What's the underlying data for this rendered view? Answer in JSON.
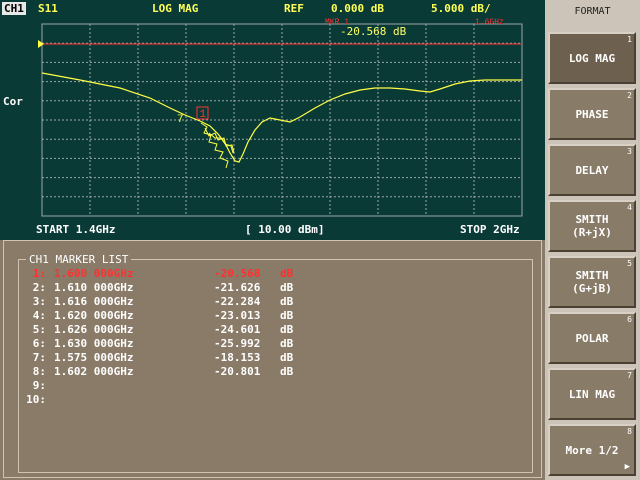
{
  "header": {
    "channel": "CH1",
    "parameter": "S11",
    "format": "LOG MAG",
    "ref_label": "REF",
    "ref_value": "0.000 dB",
    "scale": "5.000 dB/"
  },
  "graph": {
    "left_label": "Cor",
    "marker_readout": "-20.568 dB",
    "start": "START 1.4GHz",
    "power": "[ 10.00 dBm]",
    "stop": "STOP 2GHz",
    "trace_color": "#ffff44",
    "grid_color": "#9aa6a4",
    "ref_line_color": "#ff3333"
  },
  "marker_list": {
    "title": "CH1 MARKER LIST",
    "rows": [
      {
        "idx": "1:",
        "freq": "1.600 000GHz",
        "value": "-20.568",
        "unit": "dB",
        "active": true
      },
      {
        "idx": "2:",
        "freq": "1.610 000GHz",
        "value": "-21.626",
        "unit": "dB",
        "active": false
      },
      {
        "idx": "3:",
        "freq": "1.616 000GHz",
        "value": "-22.284",
        "unit": "dB",
        "active": false
      },
      {
        "idx": "4:",
        "freq": "1.620 000GHz",
        "value": "-23.013",
        "unit": "dB",
        "active": false
      },
      {
        "idx": "5:",
        "freq": "1.626 000GHz",
        "value": "-24.601",
        "unit": "dB",
        "active": false
      },
      {
        "idx": "6:",
        "freq": "1.630 000GHz",
        "value": "-25.992",
        "unit": "dB",
        "active": false
      },
      {
        "idx": "7:",
        "freq": "1.575 000GHz",
        "value": "-18.153",
        "unit": "dB",
        "active": false
      },
      {
        "idx": "8:",
        "freq": "1.602 000GHz",
        "value": "-20.801",
        "unit": "dB",
        "active": false
      },
      {
        "idx": "9:",
        "freq": "",
        "value": "",
        "unit": "",
        "active": false
      },
      {
        "idx": "10:",
        "freq": "",
        "value": "",
        "unit": "",
        "active": false
      }
    ]
  },
  "softkeys": {
    "title": "FORMAT",
    "items": [
      {
        "label": "LOG MAG",
        "num": "1",
        "selected": true
      },
      {
        "label": "PHASE",
        "num": "2",
        "selected": false
      },
      {
        "label": "DELAY",
        "num": "3",
        "selected": false
      },
      {
        "label": "SMITH\n(R+jX)",
        "num": "4",
        "selected": false
      },
      {
        "label": "SMITH\n(G+jB)",
        "num": "5",
        "selected": false
      },
      {
        "label": "POLAR",
        "num": "6",
        "selected": false
      },
      {
        "label": "LIN MAG",
        "num": "7",
        "selected": false
      },
      {
        "label": "More 1/2",
        "num": "8",
        "selected": false,
        "arrow": "▶"
      }
    ]
  }
}
